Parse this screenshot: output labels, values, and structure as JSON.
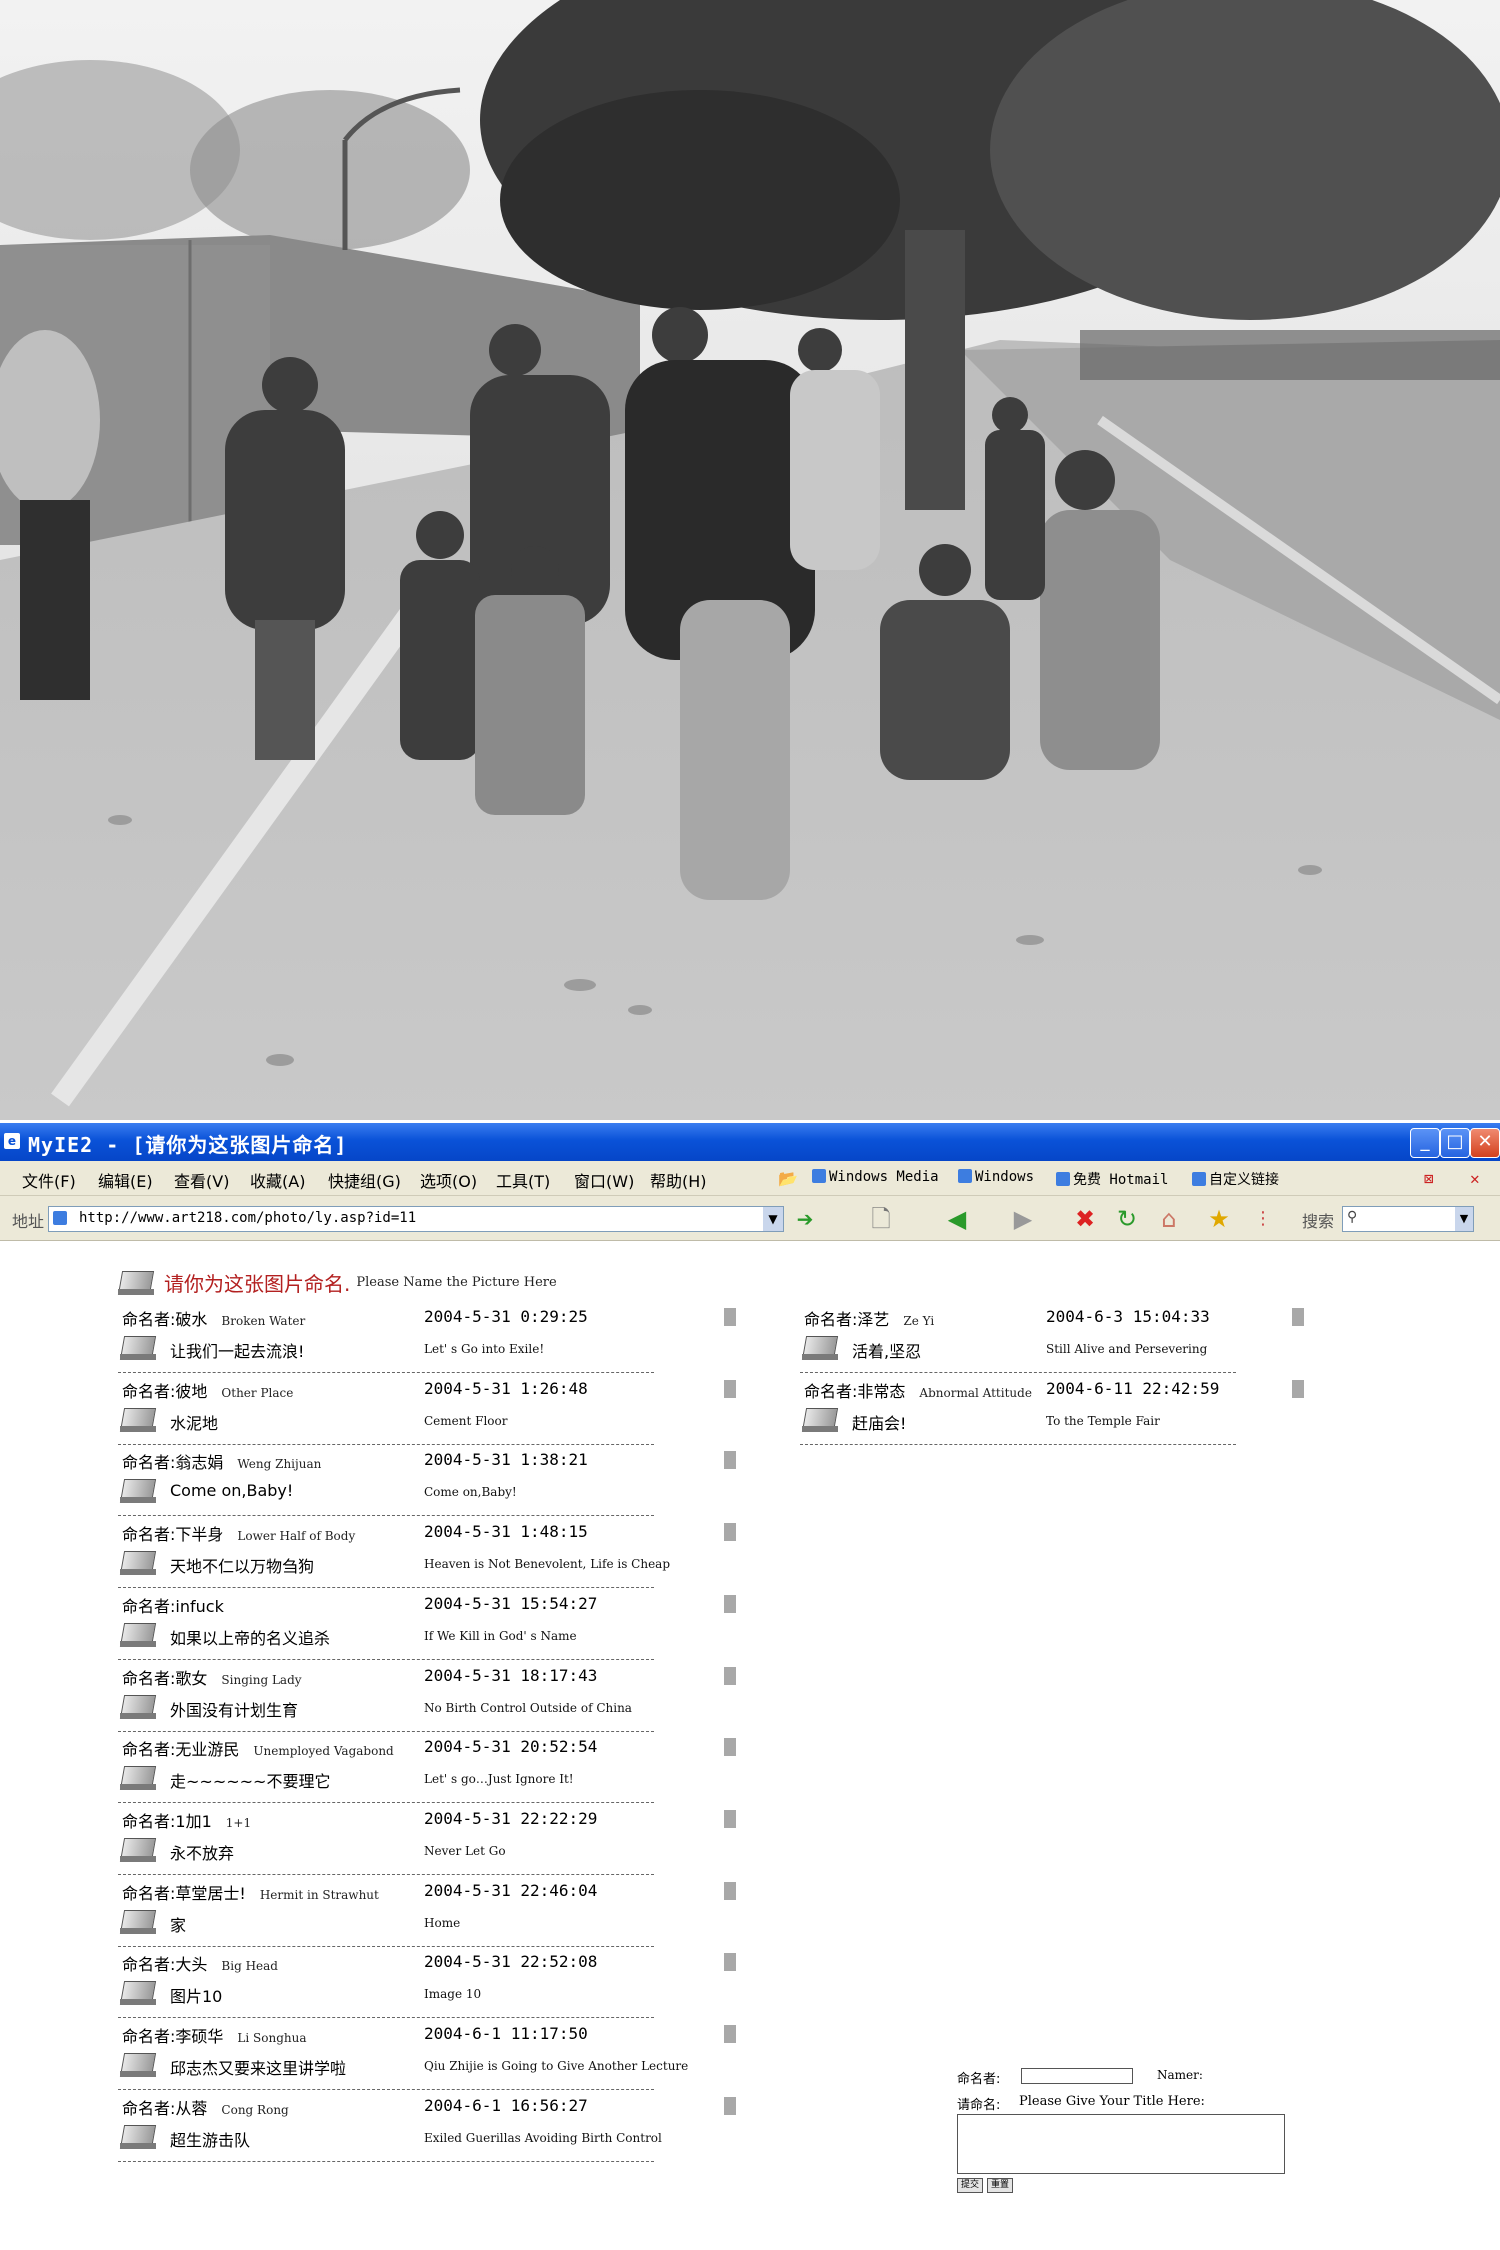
{
  "window": {
    "title": "MyIE2 - [请你为这张图片命名]",
    "minimize_icon": "minimize-icon",
    "maximize_icon": "maximize-icon",
    "close_icon": "close-icon"
  },
  "menu": [
    {
      "label": "文件(F)"
    },
    {
      "label": "编辑(E)"
    },
    {
      "label": "查看(V)"
    },
    {
      "label": "收藏(A)"
    },
    {
      "label": "快捷组(G)"
    },
    {
      "label": "选项(O)"
    },
    {
      "label": "工具(T)"
    },
    {
      "label": "窗口(W)"
    },
    {
      "label": "帮助(H)"
    }
  ],
  "links": [
    {
      "label": "Windows Media"
    },
    {
      "label": "Windows"
    },
    {
      "label": "免费 Hotmail"
    },
    {
      "label": "自定义链接"
    }
  ],
  "address": {
    "label": "地址",
    "url": "http://www.art218.com/photo/ly.asp?id=11"
  },
  "search": {
    "label": "搜索",
    "value": ""
  },
  "header": {
    "title_zh": "请你为这张图片命名.",
    "title_en": "Please Name the Picture Here"
  },
  "name_prefix": "命名者:",
  "entries_left": [
    {
      "author": "破水",
      "author_en": "Broken Water",
      "datetime": "2004-5-31 0:29:25",
      "title": "让我们一起去流浪!",
      "title_en": "Let' s Go into Exile!"
    },
    {
      "author": "彼地",
      "author_en": "Other Place",
      "datetime": "2004-5-31 1:26:48",
      "title": "水泥地",
      "title_en": "Cement Floor"
    },
    {
      "author": "翁志娟",
      "author_en": "Weng Zhijuan",
      "datetime": "2004-5-31 1:38:21",
      "title": "Come on,Baby!",
      "title_en": "Come on,Baby!"
    },
    {
      "author": "下半身",
      "author_en": "Lower Half of Body",
      "datetime": "2004-5-31 1:48:15",
      "title": "天地不仁以万物刍狗",
      "title_en": "Heaven is Not Benevolent, Life is Cheap"
    },
    {
      "author": "infuck",
      "author_en": "",
      "datetime": "2004-5-31 15:54:27",
      "title": "如果以上帝的名义追杀",
      "title_en": "If We Kill in God' s Name"
    },
    {
      "author": "歌女",
      "author_en": "Singing Lady",
      "datetime": "2004-5-31 18:17:43",
      "title": "外国没有计划生育",
      "title_en": "No Birth Control Outside of China"
    },
    {
      "author": "无业游民",
      "author_en": "Unemployed Vagabond",
      "datetime": "2004-5-31 20:52:54",
      "title": "走~~~~~~不要理它",
      "title_en": "Let' s go…Just Ignore It!"
    },
    {
      "author": "1加1",
      "author_en": "1+1",
      "datetime": "2004-5-31 22:22:29",
      "title": "永不放弃",
      "title_en": "Never Let Go"
    },
    {
      "author": "草堂居士!",
      "author_en": "Hermit in Strawhut",
      "datetime": "2004-5-31 22:46:04",
      "title": "家",
      "title_en": "Home"
    },
    {
      "author": "大头",
      "author_en": "Big Head",
      "datetime": "2004-5-31 22:52:08",
      "title": "图片10",
      "title_en": "Image 10"
    },
    {
      "author": "李硕华",
      "author_en": "Li Songhua",
      "datetime": "2004-6-1 11:17:50",
      "title": "邱志杰又要来这里讲学啦",
      "title_en": "Qiu Zhijie is Going to Give Another Lecture"
    },
    {
      "author": "从蓉",
      "author_en": "Cong Rong",
      "datetime": "2004-6-1 16:56:27",
      "title": "超生游击队",
      "title_en": "Exiled Guerillas Avoiding Birth Control"
    }
  ],
  "entries_right": [
    {
      "author": "泽艺",
      "author_en": "Ze Yi",
      "datetime": "2004-6-3 15:04:33",
      "title": "活着,坚忍",
      "title_en": "Still Alive and Persevering"
    },
    {
      "author": "非常态",
      "author_en": "Abnormal Attitude",
      "datetime": "2004-6-11 22:42:59",
      "title": "赶庙会!",
      "title_en": "To the Temple Fair"
    }
  ],
  "form": {
    "namer_label": "命名者:",
    "namer_en": "Namer:",
    "title_label": "请命名:",
    "title_en": "Please Give Your Title Here:",
    "submit": "提交",
    "reset": "重置"
  }
}
